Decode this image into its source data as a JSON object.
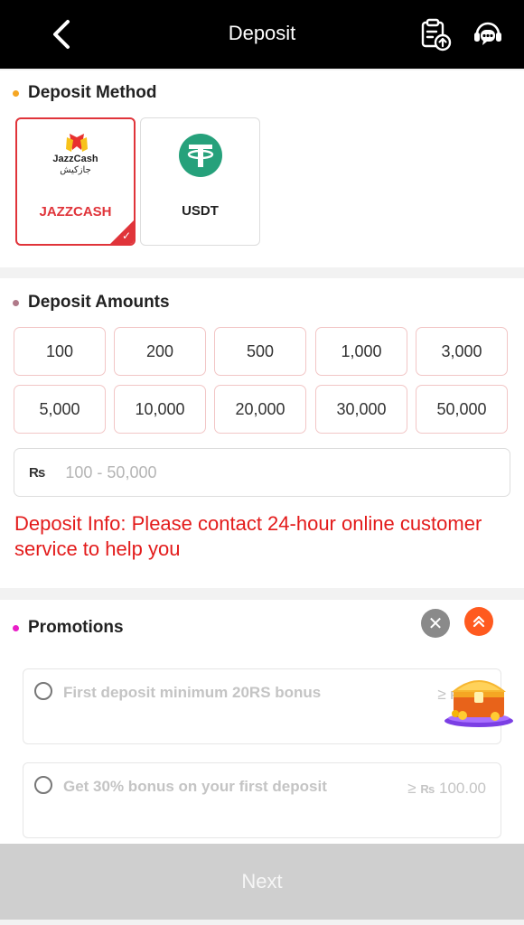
{
  "header": {
    "title": "Deposit"
  },
  "method": {
    "title": "Deposit Method",
    "options": [
      {
        "name": "JAZZCASH",
        "logo_text": "JazzCash",
        "logo_sub": "جازکیش",
        "selected": true
      },
      {
        "name": "USDT",
        "selected": false
      }
    ]
  },
  "amounts": {
    "title": "Deposit Amounts",
    "values": [
      "100",
      "200",
      "500",
      "1,000",
      "3,000",
      "5,000",
      "10,000",
      "20,000",
      "30,000",
      "50,000"
    ],
    "currency": "₨",
    "placeholder": "100 - 50,000",
    "info": "Deposit Info: Please contact 24-hour online customer service to help you"
  },
  "promotions": {
    "title": "Promotions",
    "items": [
      {
        "label": "First deposit minimum 20RS bonus",
        "min_prefix": "≥",
        "currency": "₨",
        "min_value": "10"
      },
      {
        "label": "Get 30% bonus on your first deposit",
        "min_prefix": "≥",
        "currency": "₨",
        "min_value": "100.00"
      }
    ]
  },
  "next_label": "Next",
  "colors": {
    "accent": "#e0343a",
    "info": "#e31b1b",
    "method_dot": "#f5a623",
    "amount_dot": "#b07a8a",
    "promo_dot": "#e91ec7"
  }
}
